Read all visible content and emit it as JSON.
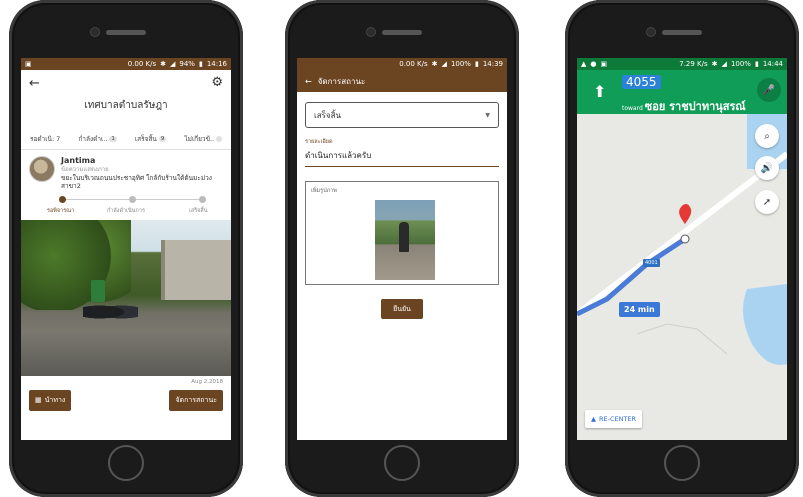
{
  "phone1": {
    "status": {
      "left_icons": "▣",
      "speed": "0.00 K/s",
      "battery": "94%",
      "time": "14:16"
    },
    "header": {
      "title": "เทศบาลตำบลรัษฎา"
    },
    "tabs": [
      {
        "label": "รอดำเนิ:",
        "count": "7"
      },
      {
        "label": "กำลังดำเ..",
        "count": "1"
      },
      {
        "label": "เสร็จสิ้น",
        "count": "9"
      },
      {
        "label": "ไม่เกี่ยวข้..",
        "count": ""
      }
    ],
    "report": {
      "name": "Jantima",
      "subtitle": "ข้อความแสดงภาย",
      "message": "ขยะในบริเวณถนนประชาอุทิศ ใกล้กับร้านใต้ต้นมะม่วงสาขา2",
      "date": "Aug 2,2018"
    },
    "stepper": [
      "รอพิจารณา",
      "กำลังดำเนินการ",
      "เสร็จสิ้น"
    ],
    "buttons": {
      "navigate": "นำทาง",
      "manage": "จัดการสถานะ"
    }
  },
  "phone2": {
    "status": {
      "speed": "0.00 K/s",
      "battery": "100%",
      "time": "14:39"
    },
    "header": {
      "title": "จัดการสถานะ"
    },
    "select_value": "เสร็จสิ้น",
    "detail_label": "รายละเอียด",
    "detail_value": "ดำเนินการแล้วครับ",
    "image_label": "เพิ่มรูปภาพ",
    "confirm": "ยืนยัน"
  },
  "phone3": {
    "status": {
      "speed": "7.29 K/s",
      "battery": "100%",
      "time": "14:44"
    },
    "route_number": "4055",
    "toward_prefix": "toward",
    "toward_road": "ซอย ราชปาทานุสรณ์",
    "eta": "24 min",
    "road_label": "4001",
    "recenter": "RE-CENTER"
  }
}
